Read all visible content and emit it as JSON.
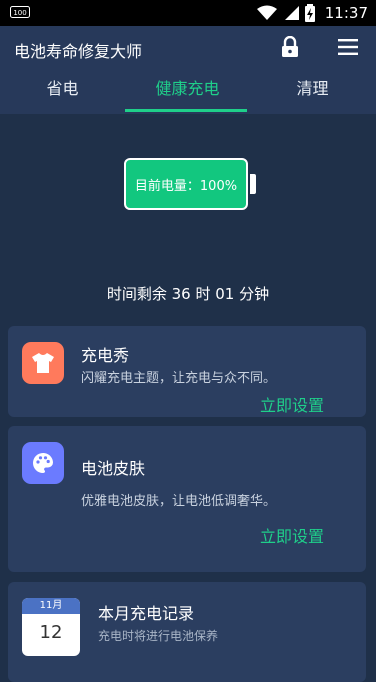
{
  "status_bar": {
    "time": "11:37",
    "left_badge": "100"
  },
  "header": {
    "title": "电池寿命修复大师",
    "tabs": [
      {
        "label": "省电",
        "active": false
      },
      {
        "label": "健康充电",
        "active": true
      },
      {
        "label": "清理",
        "active": false
      }
    ]
  },
  "battery": {
    "label": "目前电量：100%",
    "level": 1.0
  },
  "remaining": "时间剩余 36 时 01 分钟",
  "cards": [
    {
      "title": "充电秀",
      "desc": "闪耀充电主题，让充电与众不同。",
      "action": "立即设置",
      "icon": "tshirt-icon",
      "color": "#ff7a5c"
    },
    {
      "title": "电池皮肤",
      "desc": "优雅电池皮肤，让电池低调奢华。",
      "action": "立即设置",
      "icon": "palette-icon",
      "color": "#6b7bff"
    },
    {
      "title": "本月充电记录",
      "desc": "充电时将进行电池保养",
      "cal_month": "11月",
      "cal_day": "12"
    }
  ],
  "colors": {
    "accent": "#1fcf8a",
    "background": "#1f3049",
    "card": "#2b3e60"
  }
}
